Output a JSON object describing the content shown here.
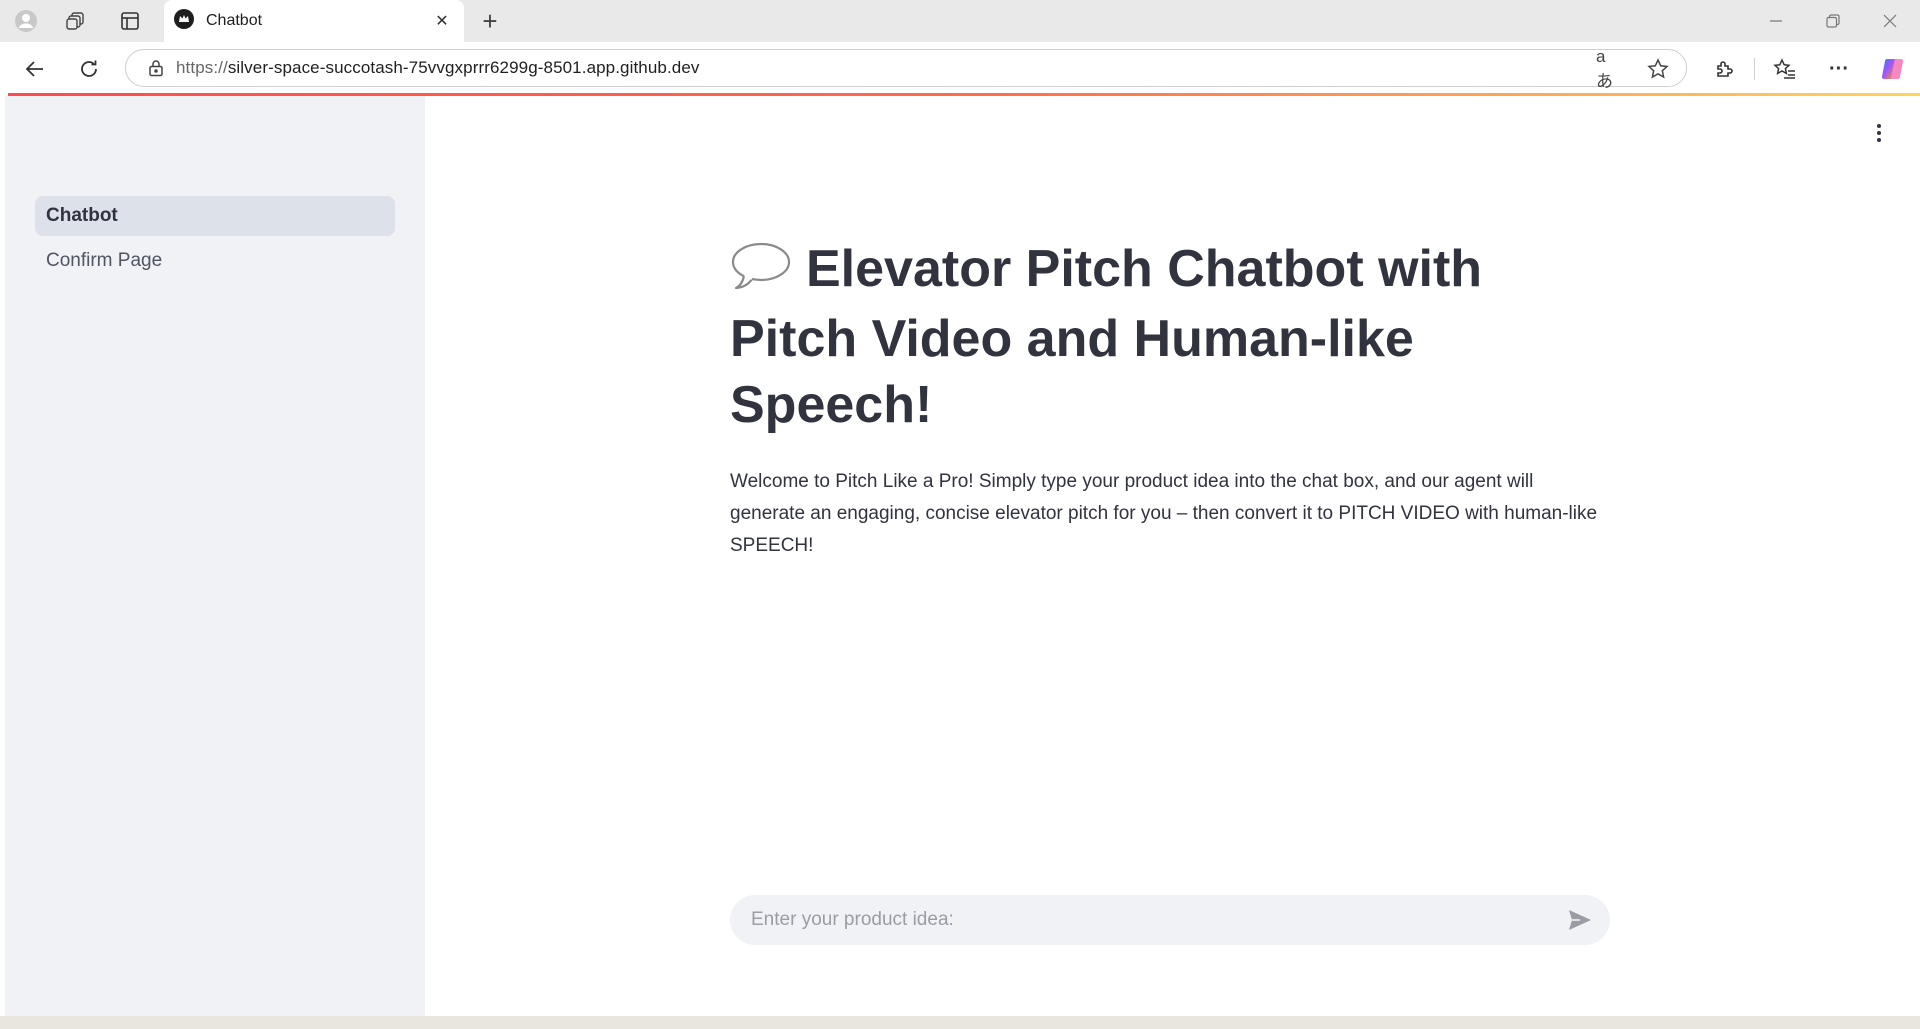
{
  "browser": {
    "tab_title": "Chatbot",
    "url_protocol": "https://",
    "url_rest": "silver-space-succotash-75vvgxprrr6299g-8501.app.github.dev",
    "read_aloud_label": "aあ"
  },
  "sidebar": {
    "items": [
      {
        "label": "Chatbot",
        "active": true
      },
      {
        "label": "Confirm Page",
        "active": false
      }
    ]
  },
  "main": {
    "title_icon": "speech-bubble-icon",
    "title": "Elevator Pitch Chatbot with Pitch Video and Human-like Speech!",
    "description": "Welcome to Pitch Like a Pro! Simply type your product idea into the chat box, and our agent will generate an engaging, concise elevator pitch for you – then convert it to PITCH VIDEO with human-like SPEECH!",
    "chat_placeholder": "Enter your product idea:"
  },
  "colors": {
    "accent": "#ff4b4b",
    "sidebar_bg": "#f0f2f6",
    "text": "#31333f"
  }
}
